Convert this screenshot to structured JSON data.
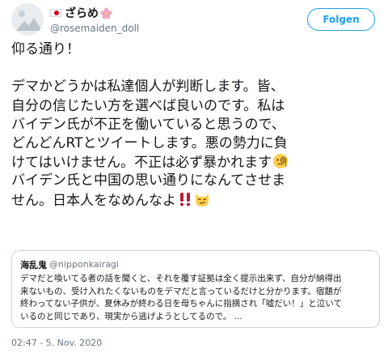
{
  "author": {
    "display_name": "ざらめ",
    "handle": "@rosemaiden_doll",
    "flag_icon": "japan-flag-icon",
    "name_suffix_icon": "cherry-blossom-icon"
  },
  "follow_button_label": "Folgen",
  "body": {
    "line1": "仰る通り！",
    "line2": "デマかどうかは私達個人が判断します。皆、",
    "line3": "自分の信じたい方を選べば良いのです。私は",
    "line4": "バイデン氏が不正を働いていると思うので、",
    "line5": "どんどんRTとツイートします。悪の勢力に負",
    "line6": "けてはいけません。不正は必ず暴かれます",
    "line7": "バイデン氏と中国の思い通りになんてさせま",
    "line8": "せん。日本人をなめんなよ"
  },
  "emojis": {
    "line6_end": "monocle-face-icon",
    "line8_end_1": "double-exclamation-icon",
    "line8_end_2": "smirking-cat-icon"
  },
  "quote": {
    "name": "海乱鬼",
    "handle": "@nipponkairagi",
    "line1": "デマだと喚いてる者の話を聞くと、それを覆す証拠は全く提示出来ず、自分が納得出",
    "line2": "来ないもの、受け入れたくないものをデマだと言っているだけと分かります。宿題が",
    "line3": "終わってない子供が、夏休みが終わる日を母ちゃんに指摘され「嘘だい！」と泣いて",
    "line4": "いるのと同じであり、現実から逃げようとしてるので。 ..."
  },
  "timestamp": "02:47 - 5. Nov. 2020",
  "colors": {
    "accent": "#1da1f2",
    "text": "#14171a",
    "secondary_text": "#657786",
    "border": "#ccd6dd",
    "flag_red": "#d0021b"
  }
}
